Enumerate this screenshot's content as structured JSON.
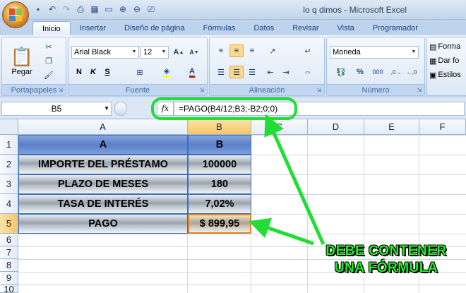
{
  "window": {
    "title": "lo q dimos - Microsoft Excel"
  },
  "quick_access": [
    "save-icon",
    "undo-icon",
    "redo-icon",
    "print-preview-icon",
    "table-icon",
    "open-icon",
    "zoom-in-icon",
    "zoom-out-icon",
    "print-icon"
  ],
  "tabs": [
    "Inicio",
    "Insertar",
    "Diseño de página",
    "Fórmulas",
    "Datos",
    "Revisar",
    "Vista",
    "Programador"
  ],
  "active_tab": "Inicio",
  "ribbon": {
    "clipboard": {
      "label": "Portapapeles",
      "paste_label": "Pegar"
    },
    "font": {
      "label": "Fuente",
      "font_name": "Arial Black",
      "font_size": "12",
      "bold": "N",
      "italic": "K",
      "underline": "S"
    },
    "alignment": {
      "label": "Alineación"
    },
    "number": {
      "label": "Número",
      "format": "Moneda",
      "percent": "%",
      "thousands": "000"
    },
    "styles": {
      "items": [
        "Forma",
        "Dar fo",
        "Estilos"
      ]
    }
  },
  "formula_bar": {
    "name_box": "B5",
    "fx_label": "fx",
    "formula": "=PAGO(B4/12;B3;-B2;0;0)"
  },
  "sheet": {
    "columns": [
      "A",
      "B",
      "C",
      "D",
      "E",
      "F"
    ],
    "rows": [
      "1",
      "2",
      "3",
      "4",
      "5",
      "6",
      "7",
      "8",
      "9",
      "10"
    ],
    "header_row": [
      "A",
      "B"
    ],
    "labels": [
      "IMPORTE DEL PRÉSTAMO",
      "PLAZO DE MESES",
      "TASA DE INTERÉS",
      "PAGO"
    ],
    "values": [
      "100000",
      "180",
      "7,02%",
      "$ 899,95"
    ],
    "active_cell": "B5"
  },
  "annotation": {
    "line1": "DEBE CONTENER",
    "line2": "UNA FÓRMULA",
    "color": "#22ee22"
  },
  "colors": {
    "ring": "#22dd33",
    "header_fill": "#5b80c8",
    "active_border": "#d8832c"
  }
}
